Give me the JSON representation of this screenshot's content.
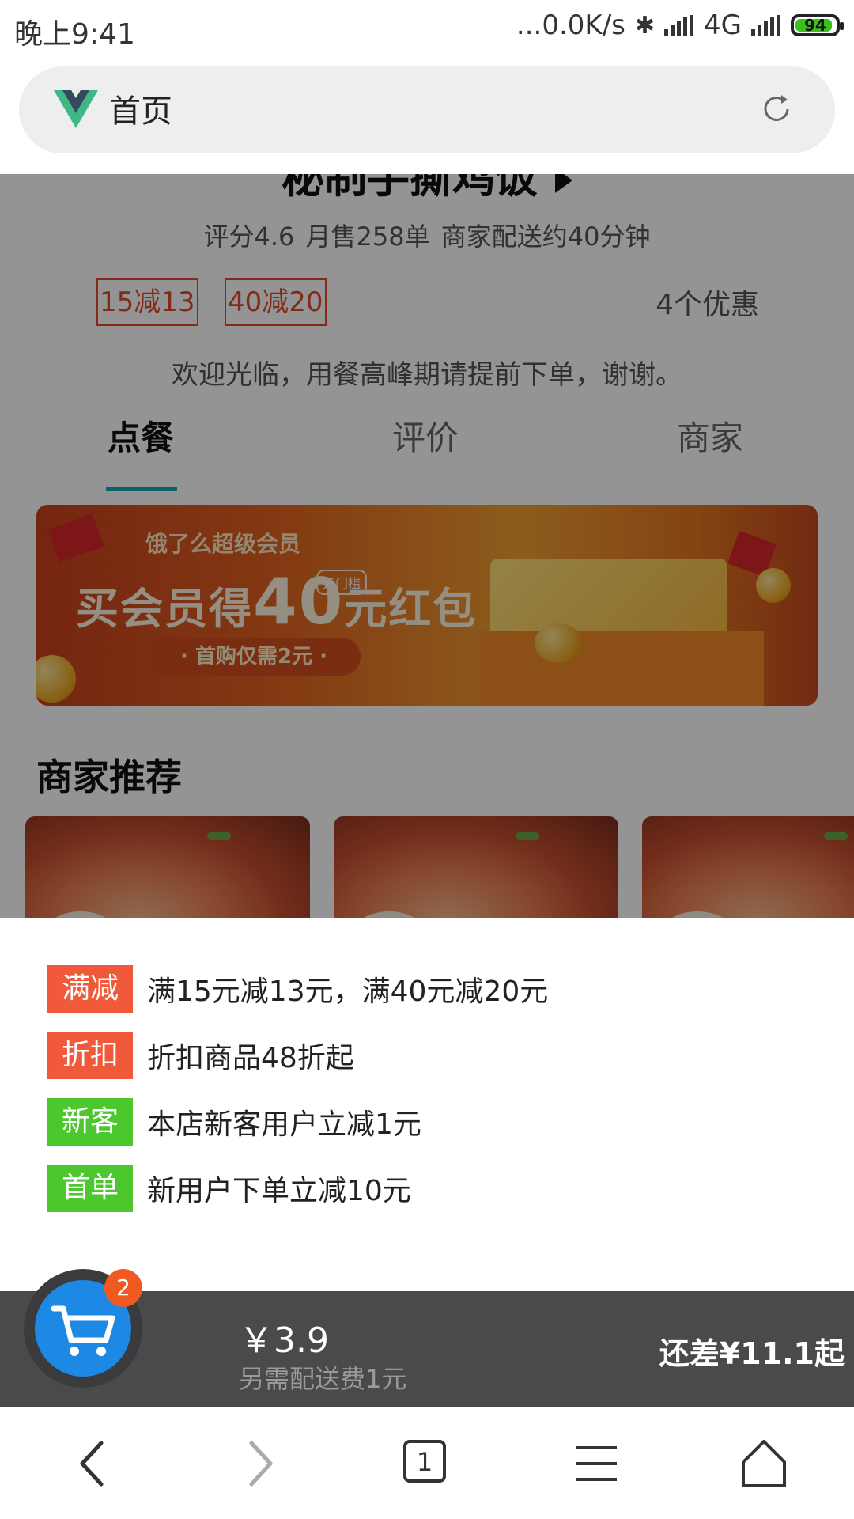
{
  "status_bar": {
    "time": "晚上9:41",
    "network_speed": "...0.0K/s",
    "network_type": "4G",
    "battery": "94"
  },
  "browser": {
    "page_title": "首页",
    "tab_count": "1"
  },
  "shop": {
    "name": "秘制手撕鸡饭",
    "stats": "评分4.6 月售258单 商家配送约40分钟",
    "tags": [
      "15减13",
      "40减20"
    ],
    "promo_count": "4个优惠",
    "welcome": "欢迎光临，用餐高峰期请提前下单，谢谢。",
    "tabs": [
      "点餐",
      "评价",
      "商家"
    ],
    "active_tab": "点餐",
    "banner": {
      "subtitle": "饿了么超级会员",
      "headline_prefix": "买会员得",
      "headline_amount": "40",
      "headline_suffix": "元红包",
      "badge": "无门槛",
      "button": "· 首购仅需2元 ·"
    },
    "section_title": "商家推荐"
  },
  "promotions": [
    {
      "badge": "满减",
      "text": "满15元减13元，满40元减20元",
      "color": "#f05a3a"
    },
    {
      "badge": "折扣",
      "text": "折扣商品48折起",
      "color": "#f05a3a"
    },
    {
      "badge": "新客",
      "text": "本店新客用户立减1元",
      "color": "#4cc72e"
    },
    {
      "badge": "首单",
      "text": "新用户下单立减10元",
      "color": "#4cc72e"
    }
  ],
  "cart": {
    "count": "2",
    "price": "￥3.9",
    "delivery_note": "另需配送费1元",
    "remaining": "还差¥11.1起"
  },
  "colors": {
    "accent_tab": "#1aa6b7",
    "cart_blue": "#1e88e5",
    "badge_orange": "#f05a22"
  }
}
